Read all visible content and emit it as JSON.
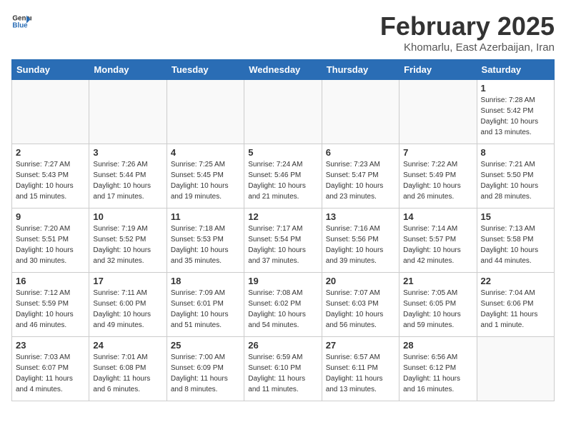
{
  "header": {
    "logo_general": "General",
    "logo_blue": "Blue",
    "month_title": "February 2025",
    "location": "Khomarlu, East Azerbaijan, Iran"
  },
  "weekdays": [
    "Sunday",
    "Monday",
    "Tuesday",
    "Wednesday",
    "Thursday",
    "Friday",
    "Saturday"
  ],
  "weeks": [
    [
      {
        "day": "",
        "empty": true
      },
      {
        "day": "",
        "empty": true
      },
      {
        "day": "",
        "empty": true
      },
      {
        "day": "",
        "empty": true
      },
      {
        "day": "",
        "empty": true
      },
      {
        "day": "",
        "empty": true
      },
      {
        "day": "1",
        "sunrise": "7:28 AM",
        "sunset": "5:42 PM",
        "daylight": "10 hours and 13 minutes."
      }
    ],
    [
      {
        "day": "2",
        "sunrise": "7:27 AM",
        "sunset": "5:43 PM",
        "daylight": "10 hours and 15 minutes."
      },
      {
        "day": "3",
        "sunrise": "7:26 AM",
        "sunset": "5:44 PM",
        "daylight": "10 hours and 17 minutes."
      },
      {
        "day": "4",
        "sunrise": "7:25 AM",
        "sunset": "5:45 PM",
        "daylight": "10 hours and 19 minutes."
      },
      {
        "day": "5",
        "sunrise": "7:24 AM",
        "sunset": "5:46 PM",
        "daylight": "10 hours and 21 minutes."
      },
      {
        "day": "6",
        "sunrise": "7:23 AM",
        "sunset": "5:47 PM",
        "daylight": "10 hours and 23 minutes."
      },
      {
        "day": "7",
        "sunrise": "7:22 AM",
        "sunset": "5:49 PM",
        "daylight": "10 hours and 26 minutes."
      },
      {
        "day": "8",
        "sunrise": "7:21 AM",
        "sunset": "5:50 PM",
        "daylight": "10 hours and 28 minutes."
      }
    ],
    [
      {
        "day": "9",
        "sunrise": "7:20 AM",
        "sunset": "5:51 PM",
        "daylight": "10 hours and 30 minutes."
      },
      {
        "day": "10",
        "sunrise": "7:19 AM",
        "sunset": "5:52 PM",
        "daylight": "10 hours and 32 minutes."
      },
      {
        "day": "11",
        "sunrise": "7:18 AM",
        "sunset": "5:53 PM",
        "daylight": "10 hours and 35 minutes."
      },
      {
        "day": "12",
        "sunrise": "7:17 AM",
        "sunset": "5:54 PM",
        "daylight": "10 hours and 37 minutes."
      },
      {
        "day": "13",
        "sunrise": "7:16 AM",
        "sunset": "5:56 PM",
        "daylight": "10 hours and 39 minutes."
      },
      {
        "day": "14",
        "sunrise": "7:14 AM",
        "sunset": "5:57 PM",
        "daylight": "10 hours and 42 minutes."
      },
      {
        "day": "15",
        "sunrise": "7:13 AM",
        "sunset": "5:58 PM",
        "daylight": "10 hours and 44 minutes."
      }
    ],
    [
      {
        "day": "16",
        "sunrise": "7:12 AM",
        "sunset": "5:59 PM",
        "daylight": "10 hours and 46 minutes."
      },
      {
        "day": "17",
        "sunrise": "7:11 AM",
        "sunset": "6:00 PM",
        "daylight": "10 hours and 49 minutes."
      },
      {
        "day": "18",
        "sunrise": "7:09 AM",
        "sunset": "6:01 PM",
        "daylight": "10 hours and 51 minutes."
      },
      {
        "day": "19",
        "sunrise": "7:08 AM",
        "sunset": "6:02 PM",
        "daylight": "10 hours and 54 minutes."
      },
      {
        "day": "20",
        "sunrise": "7:07 AM",
        "sunset": "6:03 PM",
        "daylight": "10 hours and 56 minutes."
      },
      {
        "day": "21",
        "sunrise": "7:05 AM",
        "sunset": "6:05 PM",
        "daylight": "10 hours and 59 minutes."
      },
      {
        "day": "22",
        "sunrise": "7:04 AM",
        "sunset": "6:06 PM",
        "daylight": "11 hours and 1 minute."
      }
    ],
    [
      {
        "day": "23",
        "sunrise": "7:03 AM",
        "sunset": "6:07 PM",
        "daylight": "11 hours and 4 minutes."
      },
      {
        "day": "24",
        "sunrise": "7:01 AM",
        "sunset": "6:08 PM",
        "daylight": "11 hours and 6 minutes."
      },
      {
        "day": "25",
        "sunrise": "7:00 AM",
        "sunset": "6:09 PM",
        "daylight": "11 hours and 8 minutes."
      },
      {
        "day": "26",
        "sunrise": "6:59 AM",
        "sunset": "6:10 PM",
        "daylight": "11 hours and 11 minutes."
      },
      {
        "day": "27",
        "sunrise": "6:57 AM",
        "sunset": "6:11 PM",
        "daylight": "11 hours and 13 minutes."
      },
      {
        "day": "28",
        "sunrise": "6:56 AM",
        "sunset": "6:12 PM",
        "daylight": "11 hours and 16 minutes."
      },
      {
        "day": "",
        "empty": true
      }
    ]
  ],
  "labels": {
    "sunrise": "Sunrise:",
    "sunset": "Sunset:",
    "daylight": "Daylight:"
  }
}
